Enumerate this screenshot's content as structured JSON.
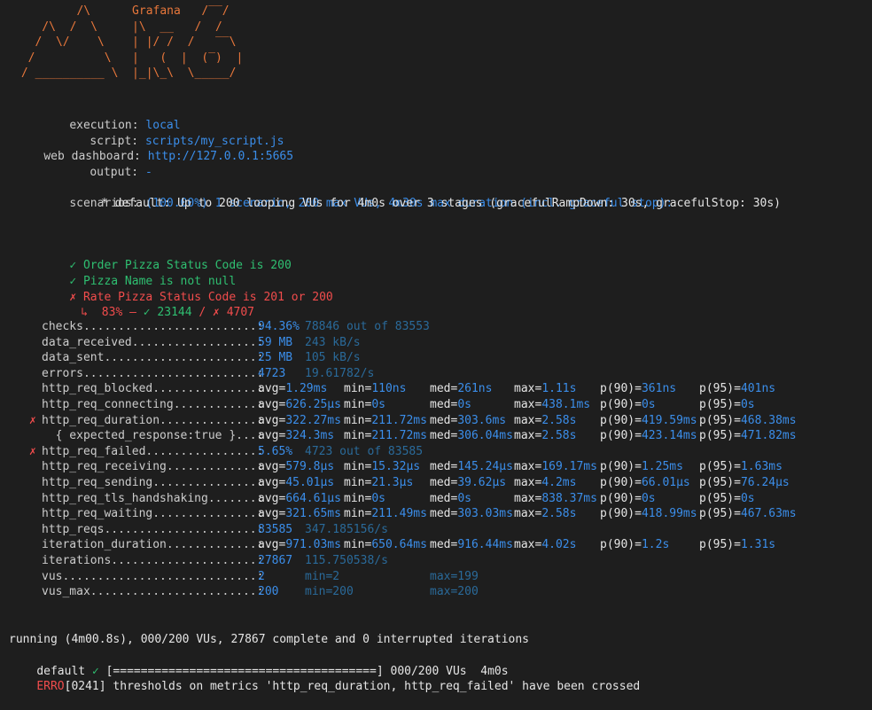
{
  "logo": {
    "brand": "Grafana",
    "ascii": "         /\\      Grafana   /‾‾/\n    /\\  /  \\     |\\  __   /  /\n   /  \\/    \\    | |/ /  /   ‾‾\\\n  /          \\   |   (  |  (‾)  |\n / __________ \\  |_|\\_\\  \\_____/"
  },
  "info": {
    "execution_label": "execution:",
    "execution_value": "local",
    "script_label": "script:",
    "script_value": "scripts/my_script.js",
    "dashboard_label": "web dashboard:",
    "dashboard_value": "http://127.0.0.1:5665",
    "output_label": "output:",
    "output_value": "-",
    "scenarios_label": "scenarios:",
    "scenarios_value": "(100.00%) 1 scenario, 200 max VUs, 4m30s max duration (incl. graceful stop):",
    "default_line": "* default: Up to 200 looping VUs for 4m0s over 3 stages (gracefulRampDown: 30s, gracefulStop: 30s)"
  },
  "checks": [
    {
      "icon": "✓",
      "text": "Order Pizza Status Code is 200",
      "status": "pass"
    },
    {
      "icon": "✓",
      "text": "Pizza Name is not null",
      "status": "pass"
    },
    {
      "icon": "✗",
      "text": "Rate Pizza Status Code is 201 or 200",
      "status": "fail"
    }
  ],
  "check_detail": {
    "arrow": "↳",
    "percent": "83%",
    "dash": "—",
    "pass_icon": "✓",
    "pass_count": "23144",
    "slash": "/",
    "fail_icon": "✗",
    "fail_count": "4707"
  },
  "metrics": [
    {
      "mark": "",
      "name": "checks.........................: ",
      "c1": "94.36%",
      "c1b": "78846 out of 83553"
    },
    {
      "mark": "",
      "name": "data_received..................: ",
      "c1": "59 MB",
      "c1b": "243 kB/s"
    },
    {
      "mark": "",
      "name": "data_sent......................: ",
      "c1": "25 MB",
      "c1b": "105 kB/s"
    },
    {
      "mark": "",
      "name": "errors.........................: ",
      "c1": "4723",
      "c1b": "19.61782/s"
    },
    {
      "mark": "",
      "name": "http_req_blocked...............: ",
      "avg": "avg=1.29ms",
      "min": "min=110ns",
      "med": "med=261ns",
      "max": "max=1.11s",
      "p90": "p(90)=361ns",
      "p95": "p(95)=401ns"
    },
    {
      "mark": "",
      "name": "http_req_connecting............: ",
      "avg": "avg=626.25µs",
      "min": "min=0s",
      "med": "med=0s",
      "max": "max=438.1ms",
      "p90": "p(90)=0s",
      "p95": "p(95)=0s"
    },
    {
      "mark": "✗",
      "name": "http_req_duration..............: ",
      "avg": "avg=322.27ms",
      "min": "min=211.72ms",
      "med": "med=303.6ms",
      "max": "max=2.58s",
      "p90": "p(90)=419.59ms",
      "p95": "p(95)=468.38ms"
    },
    {
      "mark": "",
      "name": "  { expected_response:true }...: ",
      "avg": "avg=324.3ms",
      "min": "min=211.72ms",
      "med": "med=306.04ms",
      "max": "max=2.58s",
      "p90": "p(90)=423.14ms",
      "p95": "p(95)=471.82ms"
    },
    {
      "mark": "✗",
      "name": "http_req_failed................: ",
      "c1": "5.65%",
      "c1b": "4723 out of 83585"
    },
    {
      "mark": "",
      "name": "http_req_receiving.............: ",
      "avg": "avg=579.8µs",
      "min": "min=15.32µs",
      "med": "med=145.24µs",
      "max": "max=169.17ms",
      "p90": "p(90)=1.25ms",
      "p95": "p(95)=1.63ms"
    },
    {
      "mark": "",
      "name": "http_req_sending...............: ",
      "avg": "avg=45.01µs",
      "min": "min=21.3µs",
      "med": "med=39.62µs",
      "max": "max=4.2ms",
      "p90": "p(90)=66.01µs",
      "p95": "p(95)=76.24µs"
    },
    {
      "mark": "",
      "name": "http_req_tls_handshaking.......: ",
      "avg": "avg=664.61µs",
      "min": "min=0s",
      "med": "med=0s",
      "max": "max=838.37ms",
      "p90": "p(90)=0s",
      "p95": "p(95)=0s"
    },
    {
      "mark": "",
      "name": "http_req_waiting...............: ",
      "avg": "avg=321.65ms",
      "min": "min=211.49ms",
      "med": "med=303.03ms",
      "max": "max=2.58s",
      "p90": "p(90)=418.99ms",
      "p95": "p(95)=467.63ms"
    },
    {
      "mark": "",
      "name": "http_reqs......................: ",
      "c1": "83585",
      "c1b": "347.185156/s"
    },
    {
      "mark": "",
      "name": "iteration_duration.............: ",
      "avg": "avg=971.03ms",
      "min": "min=650.64ms",
      "med": "med=916.44ms",
      "max": "max=4.02s",
      "p90": "p(90)=1.2s",
      "p95": "p(95)=1.31s"
    },
    {
      "mark": "",
      "name": "iterations.....................: ",
      "c1": "27867",
      "c1b": "115.750538/s"
    },
    {
      "mark": "",
      "name": "vus............................: ",
      "c1": "2",
      "vmin": "min=2",
      "vmax": "max=199"
    },
    {
      "mark": "",
      "name": "vus_max........................: ",
      "c1": "200",
      "vmin": "min=200",
      "vmax": "max=200"
    }
  ],
  "footer": {
    "running": "running (4m00.8s), 000/200 VUs, 27867 complete and 0 interrupted iterations",
    "default_label": "default",
    "default_check": "✓",
    "progress": "[======================================]",
    "progress_tail": "000/200 VUs  4m0s",
    "erro_label": "ERRO",
    "erro_text": "[0241] thresholds on metrics 'http_req_duration, http_req_failed' have been crossed"
  },
  "colors": {
    "background": "#1e1e1e",
    "text": "#cccccc",
    "value_blue": "#3b8eea",
    "dim_blue": "#2a6a9a",
    "pass_green": "#2fbf71",
    "fail_red": "#f14c4c",
    "logo_orange": "#e8773b"
  }
}
